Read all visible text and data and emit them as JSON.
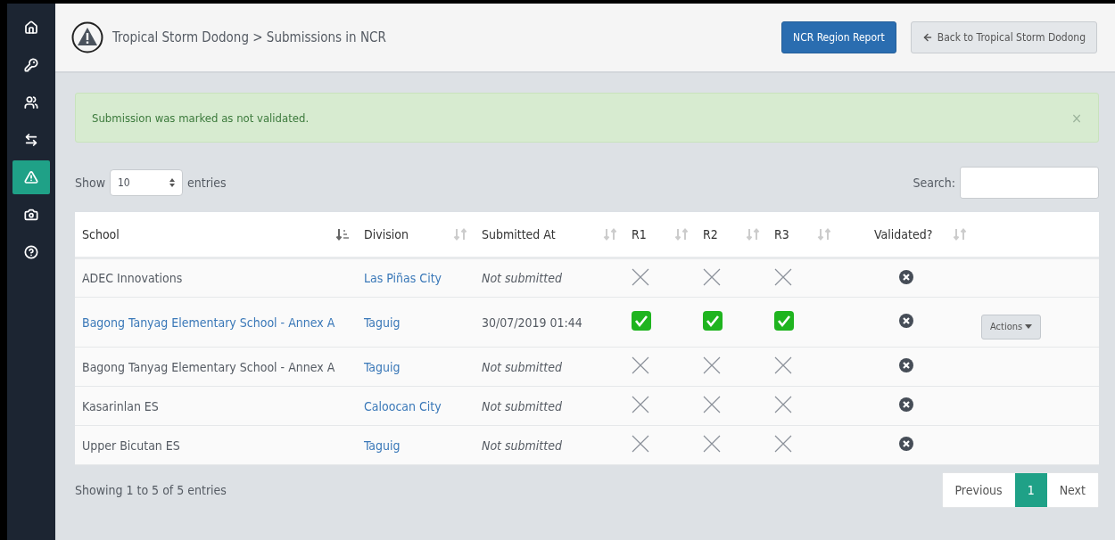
{
  "sidebar": {
    "items": [
      {
        "selected": false
      },
      {
        "selected": false
      },
      {
        "selected": false
      },
      {
        "selected": false
      },
      {
        "selected": true
      },
      {
        "selected": false
      },
      {
        "selected": false
      }
    ]
  },
  "header": {
    "breadcrumb": "Tropical Storm Dodong > Submissions in NCR",
    "buttons": [
      {
        "label": "NCR Region Report",
        "kind": "primary"
      },
      {
        "label": "Back to Tropical Storm Dodong",
        "kind": "back"
      }
    ]
  },
  "alert": {
    "message": "Submission was marked as not validated.",
    "close": "×"
  },
  "length": {
    "before": "Show",
    "value": "10",
    "after": "entries"
  },
  "search": {
    "label": "Search:"
  },
  "table": {
    "columns": [
      {
        "label": "School",
        "sorted": true
      },
      {
        "label": "Division",
        "sorted": false
      },
      {
        "label": "Submitted At",
        "sorted": false
      },
      {
        "label": "R1",
        "sorted": false
      },
      {
        "label": "R2",
        "sorted": false
      },
      {
        "label": "R3",
        "sorted": false
      },
      {
        "label": "Validated?",
        "sorted": false
      }
    ],
    "rows": [
      {
        "school": "ADEC Innovations",
        "school_link": false,
        "division": "Las Piñas City",
        "submitted_at": "Not submitted",
        "submitted": false,
        "r1": false,
        "r2": false,
        "r3": false,
        "validated": false
      },
      {
        "school": "Bagong Tanyag Elementary School - Annex A",
        "school_link": true,
        "division": "Taguig",
        "submitted_at": "30/07/2019 01:44",
        "submitted": true,
        "r1": true,
        "r2": true,
        "r3": true,
        "validated": false,
        "action": "Actions"
      },
      {
        "school": "Bagong Tanyag Elementary School - Annex A",
        "school_link": false,
        "division": "Taguig",
        "submitted_at": "Not submitted",
        "submitted": false,
        "r1": false,
        "r2": false,
        "r3": false,
        "validated": false
      },
      {
        "school": "Kasarinlan ES",
        "school_link": false,
        "division": "Caloocan City",
        "submitted_at": "Not submitted",
        "submitted": false,
        "r1": false,
        "r2": false,
        "r3": false,
        "validated": false
      },
      {
        "school": "Upper Bicutan ES",
        "school_link": false,
        "division": "Taguig",
        "submitted_at": "Not submitted",
        "submitted": false,
        "r1": false,
        "r2": false,
        "r3": false,
        "validated": false
      }
    ]
  },
  "info": "Showing 1 to 5 of 5 entries",
  "pagination": [
    {
      "label": "Previous",
      "selected": false
    },
    {
      "label": "1",
      "selected": true
    },
    {
      "label": "Next",
      "selected": false
    }
  ]
}
